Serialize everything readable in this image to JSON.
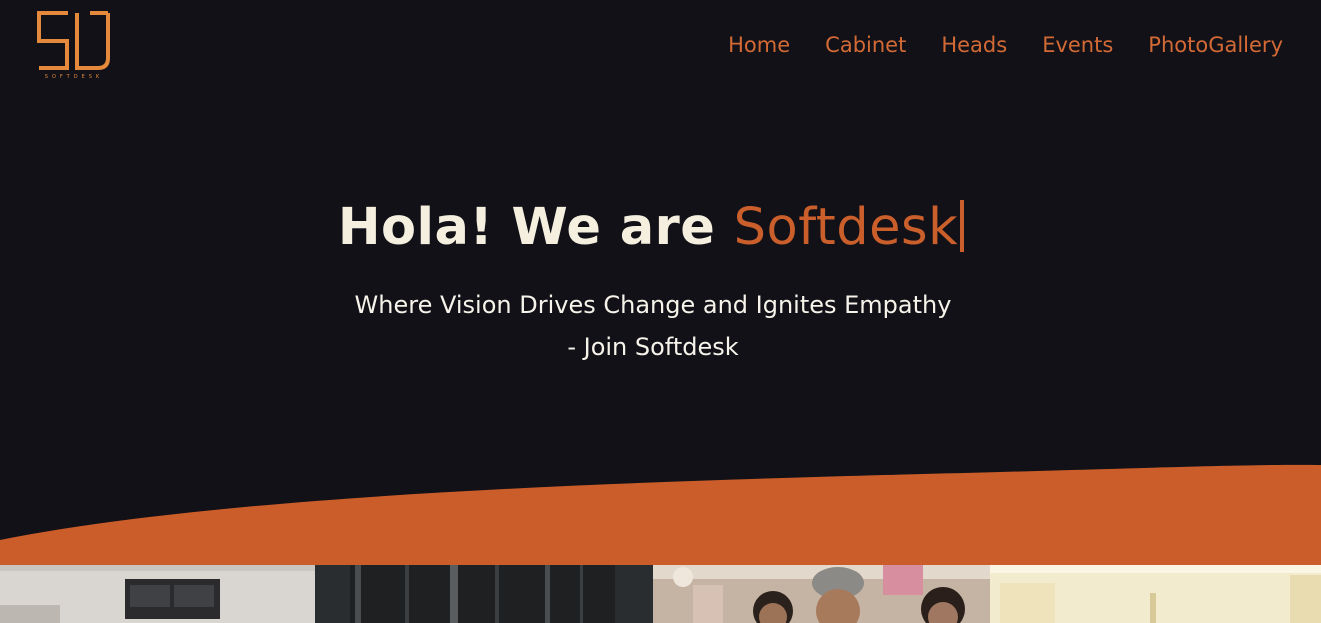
{
  "brand": {
    "logo_icon": "softdesk-sd-logo",
    "logo_caption": "SOFTDESK",
    "accent_color": "#ca5f2c",
    "background_color": "#121117",
    "heading_color": "#f4efdf"
  },
  "nav": {
    "items": [
      {
        "label": "Home"
      },
      {
        "label": "Cabinet"
      },
      {
        "label": "Heads"
      },
      {
        "label": "Events"
      },
      {
        "label": "PhotoGallery"
      }
    ]
  },
  "hero": {
    "title_prefix": "Hola! We are ",
    "title_brand": "Softdesk",
    "subtitle_line1": "Where Vision Drives Change and Ignites Empathy",
    "subtitle_line2": "- Join Softdesk"
  },
  "gallery": {
    "photos": [
      {
        "icon": "office-room-photo"
      },
      {
        "icon": "building-interior-photo"
      },
      {
        "icon": "students-group-photo"
      },
      {
        "icon": "bright-hall-photo"
      }
    ]
  }
}
